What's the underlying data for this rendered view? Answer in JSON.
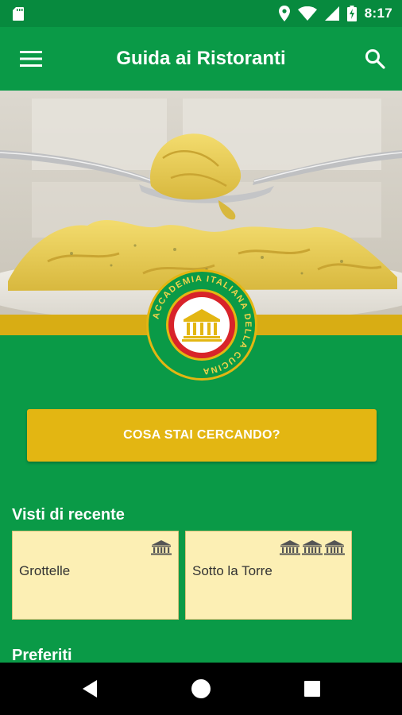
{
  "status_bar": {
    "time": "8:17",
    "icons": [
      "sd-card-icon",
      "location-icon",
      "wifi-icon",
      "cell-signal-icon",
      "battery-charging-icon"
    ]
  },
  "app_bar": {
    "title": "Guida ai Ristoranti",
    "menu_icon": "hamburger-menu-icon",
    "search_icon": "search-icon"
  },
  "logo": {
    "text": "ACCADEMIA ITALIANA DELLA CUCINA"
  },
  "search_cta": {
    "label": "COSA STAI CERCANDO?"
  },
  "recent": {
    "title": "Visti di recente",
    "items": [
      {
        "name": "Grottelle",
        "rating": 1
      },
      {
        "name": "Sotto la Torre",
        "rating": 3
      }
    ]
  },
  "favorites": {
    "title": "Preferiti"
  },
  "nav_bar": {
    "icons": [
      "back-icon",
      "home-icon",
      "recents-icon"
    ]
  },
  "colors": {
    "primary_green": "#0a9a47",
    "status_green": "#078a3e",
    "gold": "#e3b612",
    "card_bg": "#fcefb4"
  }
}
